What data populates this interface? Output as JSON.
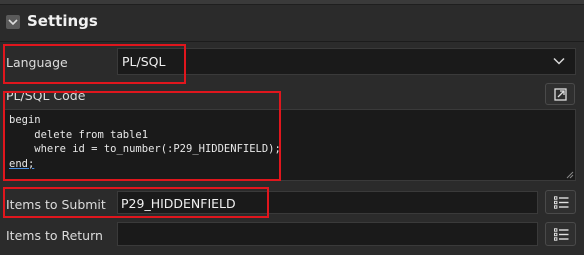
{
  "section": {
    "title": "Settings"
  },
  "language": {
    "label": "Language",
    "value": "PL/SQL"
  },
  "code": {
    "label": "PL/SQL Code",
    "lines": [
      "begin",
      "    delete from table1",
      "    where id = to_number(:P29_HIDDENFIELD);",
      "end;"
    ]
  },
  "items_to_submit": {
    "label": "Items to Submit",
    "value": "P29_HIDDENFIELD"
  },
  "items_to_return": {
    "label": "Items to Return",
    "value": ""
  },
  "colors": {
    "highlight": "#e0161d",
    "background": "#2b2b2b",
    "field": "#1a1a1a"
  },
  "icons": {
    "collapse": "chevron-down-icon",
    "select": "chevron-down-icon",
    "expand": "expand-icon",
    "list": "list-icon"
  }
}
